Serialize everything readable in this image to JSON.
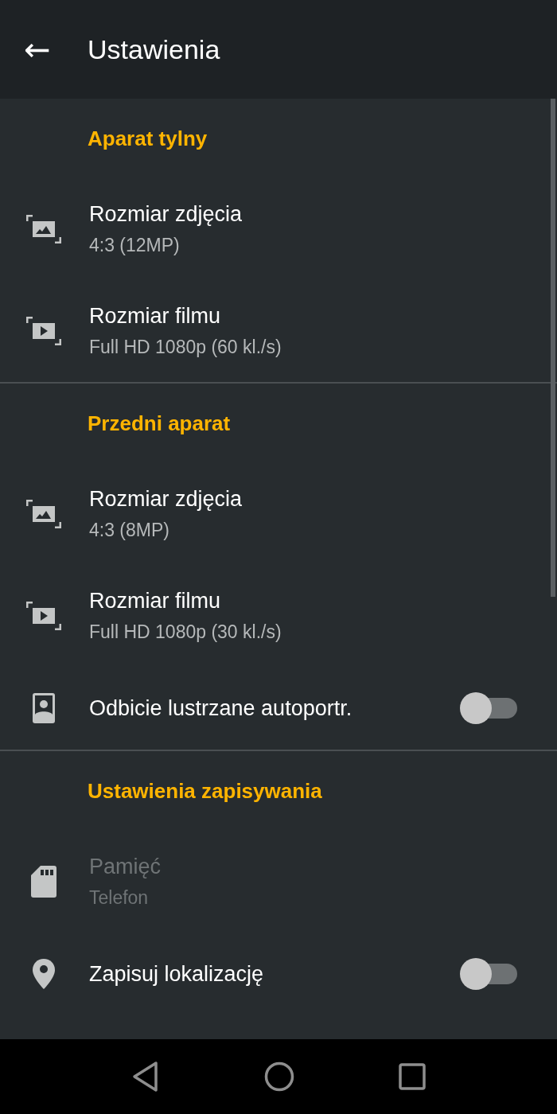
{
  "app_bar": {
    "back": "←",
    "title": "Ustawienia"
  },
  "sections": [
    {
      "header": "Aparat tylny",
      "items": [
        {
          "kind": "value",
          "title": "Rozmiar zdjęcia",
          "value": "4:3 (12MP)",
          "disabled": false
        },
        {
          "kind": "value",
          "title": "Rozmiar filmu",
          "value": "Full HD 1080p (60 kl./s)",
          "disabled": false
        }
      ]
    },
    {
      "header": "Przedni aparat",
      "items": [
        {
          "kind": "value",
          "title": "Rozmiar zdjęcia",
          "value": "4:3 (8MP)",
          "disabled": false
        },
        {
          "kind": "value",
          "title": "Rozmiar filmu",
          "value": "Full HD 1080p (30 kl./s)",
          "disabled": false
        },
        {
          "kind": "switch",
          "title": "Odbicie lustrzane autoportr.",
          "on": false
        }
      ]
    },
    {
      "header": "Ustawienia zapisywania",
      "items": [
        {
          "kind": "value",
          "title": "Pamięć",
          "value": "Telefon",
          "disabled": true
        },
        {
          "kind": "switch",
          "title": "Zapisuj lokalizację",
          "on": false
        }
      ]
    }
  ]
}
